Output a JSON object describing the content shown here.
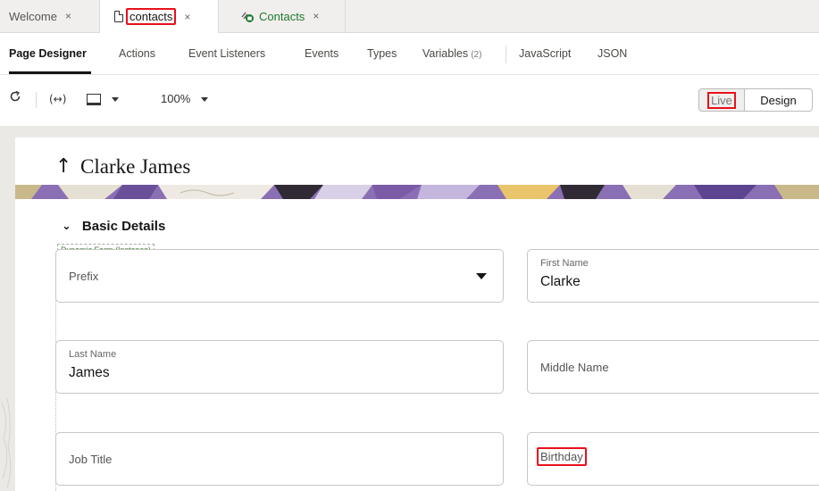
{
  "tabs": [
    {
      "label": "Welcome"
    },
    {
      "label": "contacts"
    },
    {
      "label": "Contacts"
    }
  ],
  "tab_close_glyph": "×",
  "subnav": {
    "items": [
      "Page Designer",
      "Actions",
      "Event Listeners",
      "Events",
      "Types",
      "Variables",
      "JavaScript",
      "JSON"
    ],
    "variables_count": "(2)"
  },
  "toolbar": {
    "zoom": "100%",
    "live_label": "Live",
    "design_label": "Design"
  },
  "page": {
    "title": "Clarke James",
    "section_title": "Basic Details",
    "form_label": "Dynamic Form (Instance)"
  },
  "form": {
    "prefix_placeholder": "Prefix",
    "first_name_label": "First Name",
    "first_name_value": "Clarke",
    "last_name_label": "Last Name",
    "last_name_value": "James",
    "middle_name_placeholder": "Middle Name",
    "job_title_placeholder": "Job Title",
    "birthday_placeholder": "Birthday"
  },
  "colors": {
    "highlight": "#e8111b",
    "business_object_icon": "#1f7a2e",
    "banner_purple": "#7b5aa6"
  }
}
